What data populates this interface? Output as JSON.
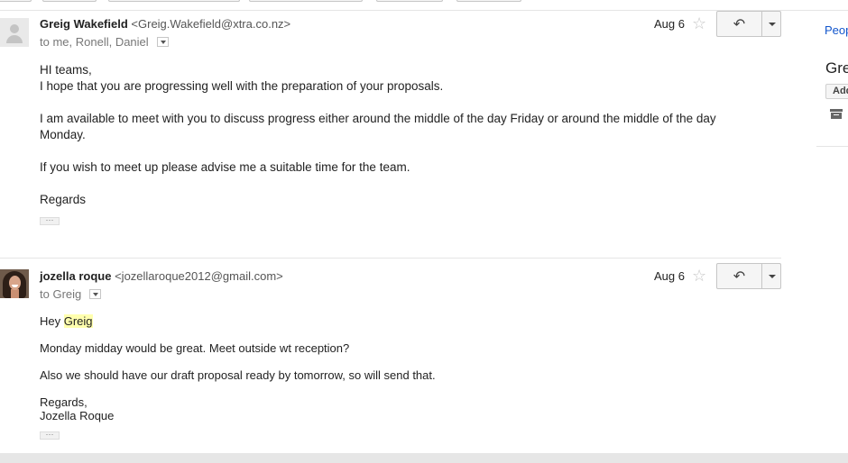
{
  "messages": [
    {
      "sender_name": "Greig Wakefield",
      "sender_email": "<Greig.Wakefield@xtra.co.nz>",
      "recipients": "to me, Ronell, Daniel",
      "date": "Aug 6",
      "body": [
        "HI teams,",
        "I hope that you are progressing well with the preparation of your proposals.",
        "I am available to meet with you to discuss progress either around the middle of the day Friday or around the middle of the day",
        "Monday.",
        "If you wish to meet up please advise me a suitable time for the team.",
        "Regards"
      ],
      "ellipsis": "···"
    },
    {
      "sender_name": "jozella roque",
      "sender_email": "<jozellaroque2012@gmail.com>",
      "recipients": "to Greig",
      "date": "Aug 6",
      "greeting_prefix": "Hey ",
      "greeting_name": "Greig",
      "body": [
        "Monday midday would be great. Meet outside wt reception?",
        "Also we should have our draft proposal ready by tomorrow, so will send that.",
        "Regards,",
        "Jozella Roque"
      ],
      "ellipsis": "···"
    }
  ],
  "sidebar": {
    "people_label": "People",
    "contact_name": "Greig",
    "add_label": "Add"
  },
  "icons": {
    "star": "star-icon",
    "reply": "reply-icon",
    "more": "chevron-down-icon",
    "archive": "archive-icon",
    "avatar_default": "person-icon"
  },
  "colors": {
    "link": "#1155cc",
    "highlight": "#ffffae",
    "star": "#c6c6c6"
  }
}
